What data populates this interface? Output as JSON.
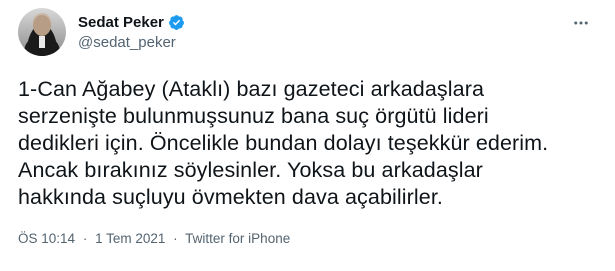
{
  "author": {
    "display_name": "Sedat Peker",
    "handle": "@sedat_peker",
    "verified": true,
    "avatar_icon": "profile-photo"
  },
  "more_icon": "more-horizontal-icon",
  "tweet": {
    "lines": [
      "1-Can Ağabey (Ataklı) bazı gazeteci arkadaşlara",
      "serzenişte bulunmuşsunuz bana suç örgütü lideri",
      "dedikleri için. Öncelikle bundan dolayı teşekkür ederim.",
      "Ancak bırakınız söylesinler. Yoksa bu arkadaşlar",
      "hakkında suçluyu övmekten dava açabilirler."
    ]
  },
  "meta": {
    "time": "ÖS 10:14",
    "separator": "·",
    "date": "1 Tem 2021",
    "source": "Twitter for iPhone"
  },
  "colors": {
    "text": "#0f1419",
    "secondary": "#536471",
    "verified": "#1d9bf0"
  }
}
